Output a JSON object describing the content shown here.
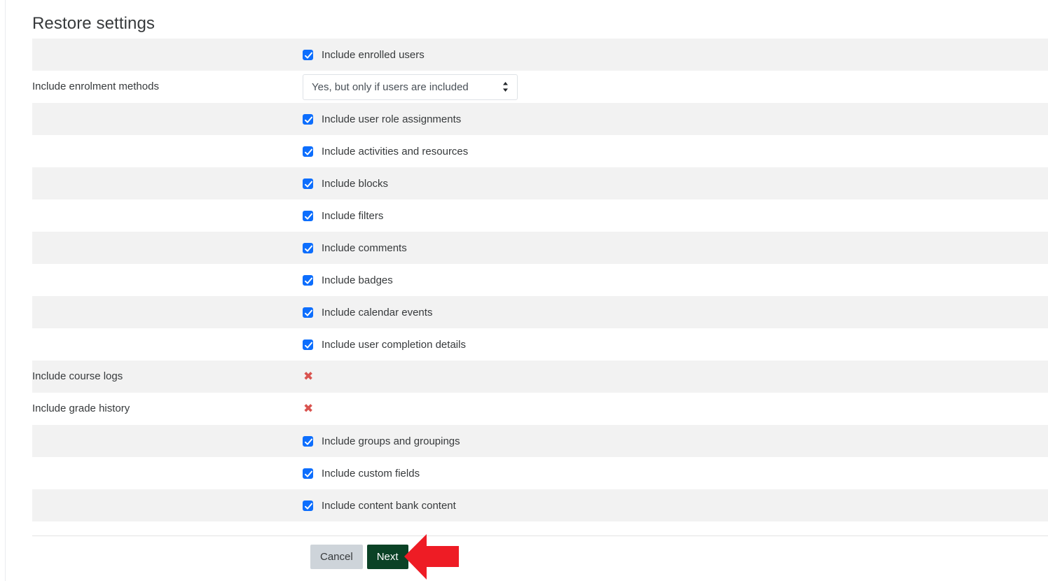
{
  "page": {
    "title": "Restore settings"
  },
  "colors": {
    "checkbox_blue": "#0d6efd",
    "xmark_red": "#d9534f",
    "next_button_green": "#0b4226",
    "cancel_button_gray": "#ced4da",
    "stripe_gray": "#f2f2f2",
    "annotation_red": "#ee1c25"
  },
  "settings": {
    "rows": [
      {
        "label": "",
        "control": "checkbox",
        "checked": true,
        "text": "Include enrolled users",
        "striped": true
      },
      {
        "label": "Include enrolment methods",
        "control": "select",
        "value": "Yes, but only if users are included",
        "text": "",
        "striped": false
      },
      {
        "label": "",
        "control": "checkbox",
        "checked": true,
        "text": "Include user role assignments",
        "striped": true
      },
      {
        "label": "",
        "control": "checkbox",
        "checked": true,
        "text": "Include activities and resources",
        "striped": false
      },
      {
        "label": "",
        "control": "checkbox",
        "checked": true,
        "text": "Include blocks",
        "striped": true
      },
      {
        "label": "",
        "control": "checkbox",
        "checked": true,
        "text": "Include filters",
        "striped": false
      },
      {
        "label": "",
        "control": "checkbox",
        "checked": true,
        "text": "Include comments",
        "striped": true
      },
      {
        "label": "",
        "control": "checkbox",
        "checked": true,
        "text": "Include badges",
        "striped": false
      },
      {
        "label": "",
        "control": "checkbox",
        "checked": true,
        "text": "Include calendar events",
        "striped": true
      },
      {
        "label": "",
        "control": "checkbox",
        "checked": true,
        "text": "Include user completion details",
        "striped": false
      },
      {
        "label": "Include course logs",
        "control": "xmark",
        "text": "✖",
        "striped": true
      },
      {
        "label": "Include grade history",
        "control": "xmark",
        "text": "✖",
        "striped": false
      },
      {
        "label": "",
        "control": "checkbox",
        "checked": true,
        "text": "Include groups and groupings",
        "striped": true
      },
      {
        "label": "",
        "control": "checkbox",
        "checked": true,
        "text": "Include custom fields",
        "striped": false
      },
      {
        "label": "",
        "control": "checkbox",
        "checked": true,
        "text": "Include content bank content",
        "striped": true
      }
    ]
  },
  "footer": {
    "cancel_label": "Cancel",
    "next_label": "Next"
  },
  "annotation": {
    "arrow": "left-pointing-red-arrow"
  }
}
